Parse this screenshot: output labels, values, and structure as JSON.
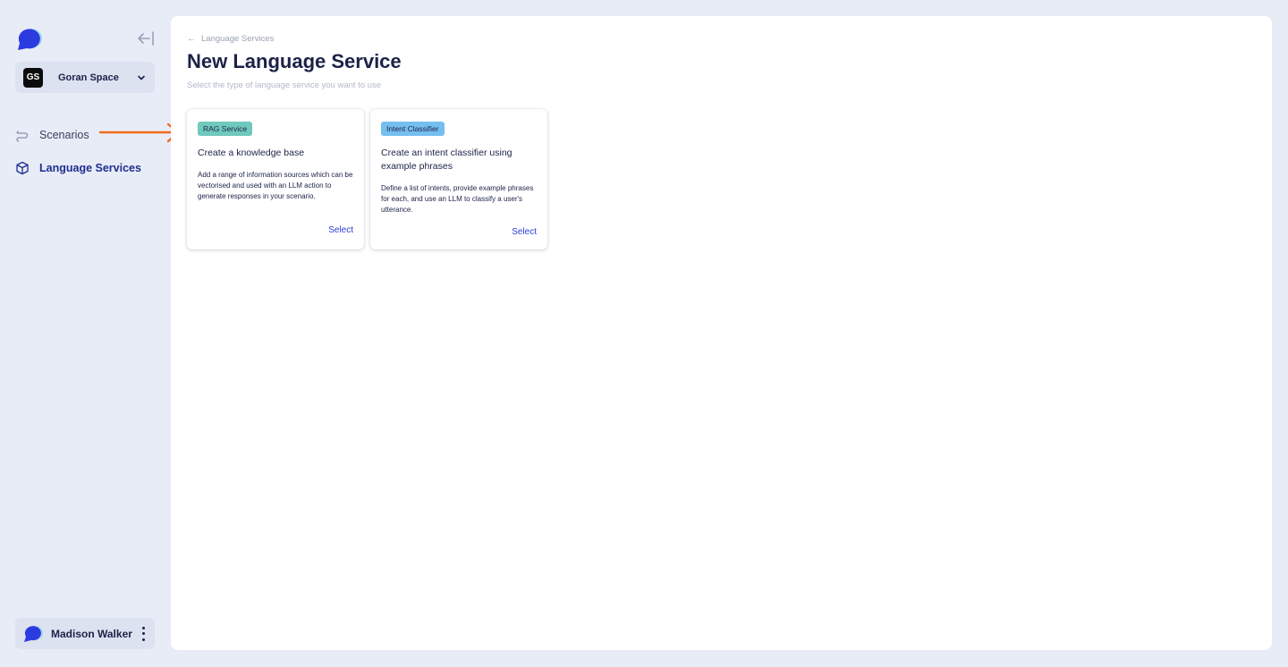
{
  "app": {
    "logo_icon": "speech-bubble-logo",
    "brand_color": "#2c3be0"
  },
  "workspace": {
    "initials": "GS",
    "name": "Goran Space"
  },
  "nav": {
    "items": [
      {
        "label": "Scenarios",
        "icon": "scenarios-icon",
        "active": false
      },
      {
        "label": "Language Services",
        "icon": "cube-icon",
        "active": true
      }
    ]
  },
  "annotation": {
    "color": "#f26a1b",
    "target": "card-rag"
  },
  "user": {
    "name": "Madison Walker"
  },
  "main": {
    "breadcrumb": "Language Services",
    "title": "New Language Service",
    "subtitle": "Select the type of language service you want to use"
  },
  "cards": [
    {
      "badge": "RAG Service",
      "badge_color": "#6fc9bd",
      "title": "Create a knowledge base",
      "description": "Add a range of information sources which can be vectorised and used with an LLM action to generate responses in your scenario.",
      "action": "Select"
    },
    {
      "badge": "Intent Classifier",
      "badge_color": "#75bff0",
      "title": "Create an intent classifier using example phrases",
      "description": "Define a list of intents, provide example phrases for each, and use an LLM to classify a user's utterance.",
      "action": "Select"
    }
  ]
}
